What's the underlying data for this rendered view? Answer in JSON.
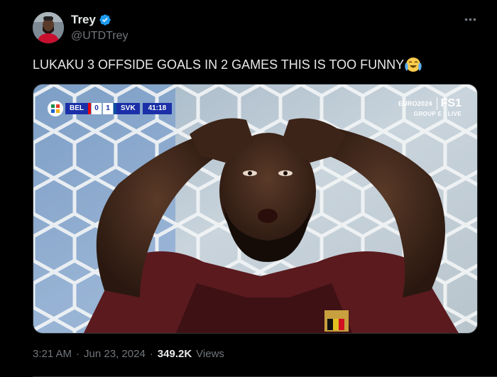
{
  "author": {
    "display_name": "Trey",
    "handle": "@UTDTrey",
    "verified": true,
    "avatar_icon": "avatar-photo"
  },
  "tweet": {
    "text": "LUKAKU 3 OFFSIDE GOALS IN 2 GAMES THIS IS TOO FUNNY",
    "emoji": "face-with-tears-emoji"
  },
  "media": {
    "scorebug": {
      "home": "BEL",
      "home_score": "0",
      "away_score": "1",
      "away": "SVK",
      "clock": "41:18"
    },
    "broadcast": {
      "tournament": "EURO2024",
      "network": "FS1",
      "status": "GROUP E · LIVE"
    }
  },
  "meta": {
    "time": "3:21 AM",
    "sep1": "·",
    "date": "Jun 23, 2024",
    "sep2": "·",
    "views_count": "349.2K",
    "views_label": "Views"
  },
  "colors": {
    "background": "#000000",
    "text": "#e7e9ea",
    "muted": "#71767b",
    "verified": "#1d9bf0",
    "scorebug_blue": "#1a2fa8"
  }
}
